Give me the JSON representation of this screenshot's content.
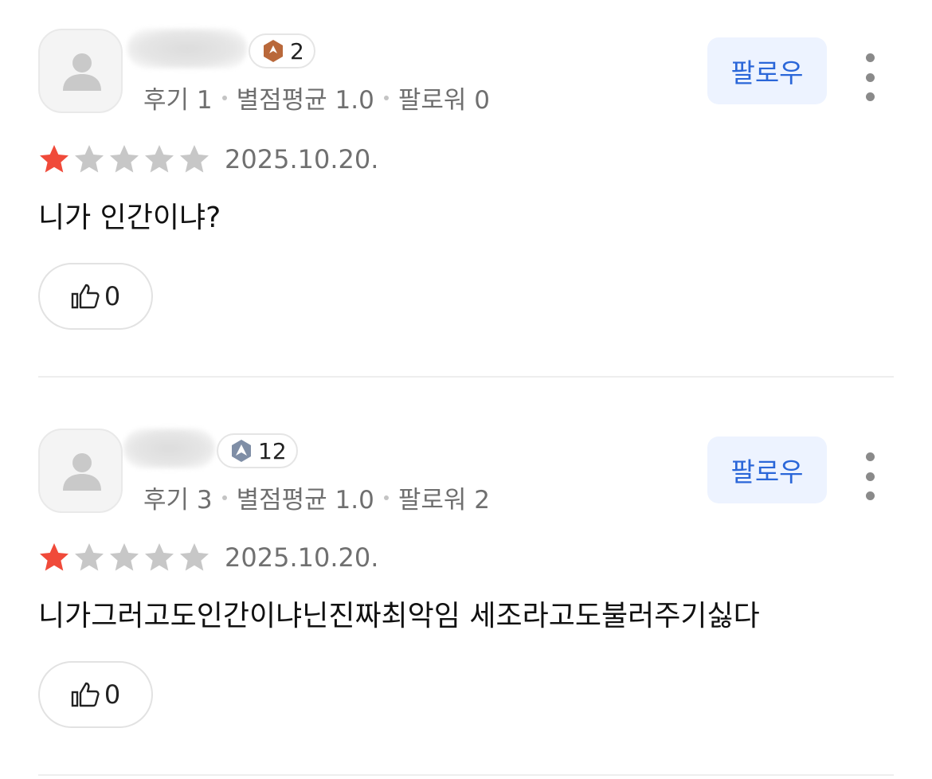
{
  "reviews": [
    {
      "badge_count": "2",
      "badge_icon": "bronze-hexagon-icon",
      "badge_color": "#b9683a",
      "stats": {
        "reviews": "후기 1",
        "avg_rating": "별점평균 1.0",
        "followers": "팔로워 0"
      },
      "follow_label": "팔로우",
      "rating": 1,
      "max_rating": 5,
      "date": "2025.10.20.",
      "text": "니가 인간이냐?",
      "likes": "0"
    },
    {
      "badge_count": "12",
      "badge_icon": "silver-hexagon-icon",
      "badge_color": "#7f8ea6",
      "stats": {
        "reviews": "후기 3",
        "avg_rating": "별점평균 1.0",
        "followers": "팔로워 2"
      },
      "follow_label": "팔로우",
      "rating": 1,
      "max_rating": 5,
      "date": "2025.10.20.",
      "text": "니가그러고도인간이냐닌진짜최악임 세조라고도불러주기싫다",
      "likes": "0"
    }
  ],
  "colors": {
    "accent": "#2a66d8",
    "follow_bg": "#edf3ff",
    "star_active": "#f04a3a",
    "star_inactive": "#c7c7c7"
  }
}
